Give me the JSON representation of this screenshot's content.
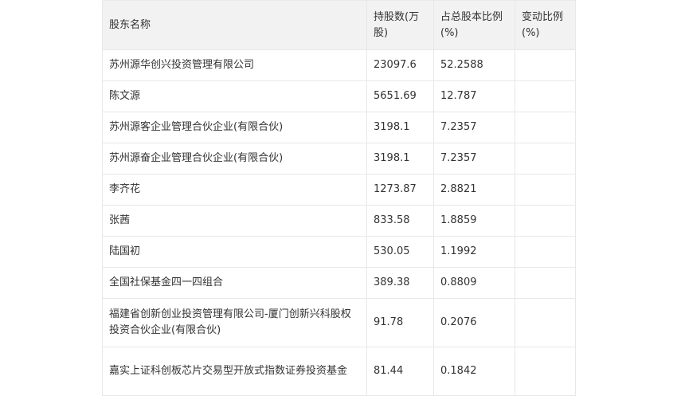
{
  "table": {
    "headers": [
      "股东名称",
      "持股数(万股)",
      "占总股本比例(%)",
      "变动比例(%)"
    ],
    "rows": [
      [
        "苏州源华创兴投资管理有限公司",
        "23097.6",
        "52.2588",
        ""
      ],
      [
        "陈文源",
        "5651.69",
        "12.787",
        ""
      ],
      [
        "苏州源客企业管理合伙企业(有限合伙)",
        "3198.1",
        "7.2357",
        ""
      ],
      [
        "苏州源奋企业管理合伙企业(有限合伙)",
        "3198.1",
        "7.2357",
        ""
      ],
      [
        "李齐花",
        "1273.87",
        "2.8821",
        ""
      ],
      [
        "张茜",
        "833.58",
        "1.8859",
        ""
      ],
      [
        "陆国初",
        "530.05",
        "1.1992",
        ""
      ],
      [
        "全国社保基金四一四组合",
        "389.38",
        "0.8809",
        ""
      ],
      [
        "福建省创新创业投资管理有限公司-厦门创新兴科股权投资合伙企业(有限合伙)",
        "91.78",
        "0.2076",
        ""
      ],
      [
        "嘉实上证科创板芯片交易型开放式指数证券投资基金",
        "81.44",
        "0.1842",
        ""
      ]
    ]
  }
}
